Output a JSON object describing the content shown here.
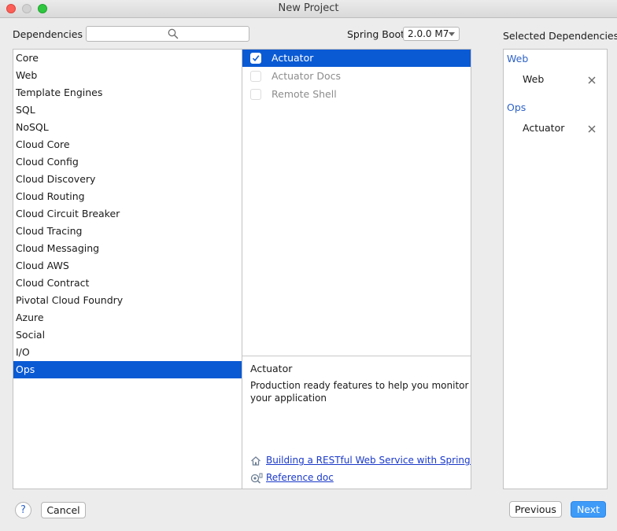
{
  "window": {
    "title": "New Project"
  },
  "dependencies_label": "Dependencies",
  "search": {
    "value": "",
    "placeholder": ""
  },
  "spring_boot": {
    "label": "Spring Boot",
    "selected_version": "2.0.0 M7"
  },
  "selected_header": "Selected Dependencies",
  "categories": [
    "Core",
    "Web",
    "Template Engines",
    "SQL",
    "NoSQL",
    "Cloud Core",
    "Cloud Config",
    "Cloud Discovery",
    "Cloud Routing",
    "Cloud Circuit Breaker",
    "Cloud Tracing",
    "Cloud Messaging",
    "Cloud AWS",
    "Cloud Contract",
    "Pivotal Cloud Foundry",
    "Azure",
    "Social",
    "I/O",
    "Ops"
  ],
  "selected_category": "Ops",
  "dependencies": [
    {
      "label": "Actuator",
      "checked": true,
      "enabled": true,
      "selected": true
    },
    {
      "label": "Actuator Docs",
      "checked": false,
      "enabled": false,
      "selected": false
    },
    {
      "label": "Remote Shell",
      "checked": false,
      "enabled": false,
      "selected": false
    }
  ],
  "description": {
    "title": "Actuator",
    "line1": "Production ready features to help you monitor and ma",
    "line2": "your application",
    "guide_link": "Building a RESTful Web Service with Spring Boot A",
    "reference_link": "Reference doc"
  },
  "selected_groups": [
    {
      "group": "Web",
      "items": [
        "Web"
      ]
    },
    {
      "group": "Ops",
      "items": [
        "Actuator"
      ]
    }
  ],
  "buttons": {
    "help": "?",
    "cancel": "Cancel",
    "previous": "Previous",
    "next": "Next"
  },
  "colors": {
    "selection": "#0a5ad4",
    "primary_button": "#3f9bf8",
    "group_label": "#2d62c7",
    "link": "#1a39c9"
  },
  "icons": {
    "search": "magnifier-icon",
    "remove": "close-x-icon",
    "guide": "home-icon",
    "reference": "reference-doc-icon"
  }
}
